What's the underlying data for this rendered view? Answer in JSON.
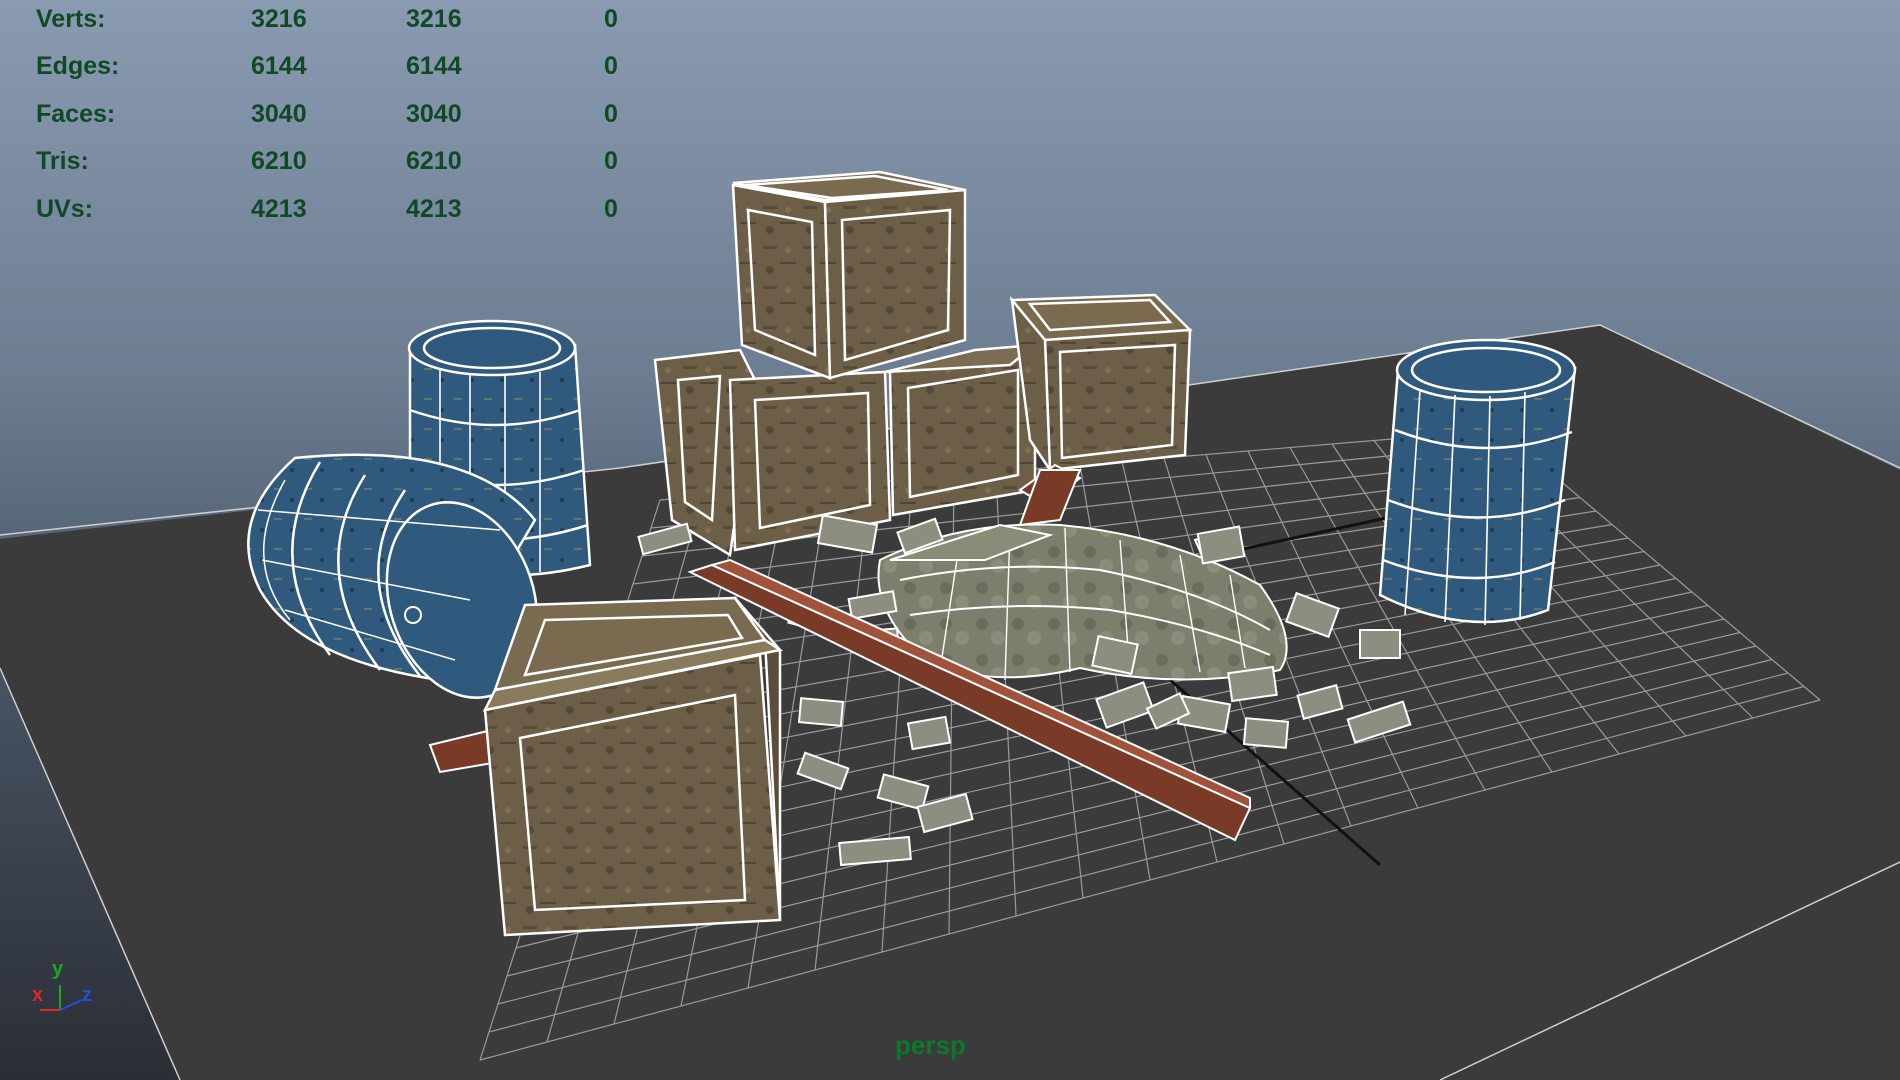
{
  "window": {
    "camera_label": "persp"
  },
  "hud": {
    "rows": [
      {
        "label": "Verts:",
        "c1": "3216",
        "c2": "3216",
        "c3": "0"
      },
      {
        "label": "Edges:",
        "c1": "6144",
        "c2": "6144",
        "c3": "0"
      },
      {
        "label": "Faces:",
        "c1": "3040",
        "c2": "3040",
        "c3": "0"
      },
      {
        "label": "Tris:",
        "c1": "6210",
        "c2": "6210",
        "c3": "0"
      },
      {
        "label": "UVs:",
        "c1": "4213",
        "c2": "4213",
        "c3": "0"
      }
    ]
  },
  "axis": {
    "x": "x",
    "y": "y",
    "z": "z"
  },
  "colors": {
    "hud_text": "#0f4a26",
    "camera_label": "#0a7a2a",
    "wireframe": "#ffffff",
    "barrel_blue": "#2f5a7d",
    "crate_wood": "#6e5f48",
    "plank_red": "#7a3a28",
    "ground": "#3a3a3a",
    "grid": "#9a9a9a"
  },
  "objects": [
    "barrel-upright-left",
    "barrel-fallen-left",
    "barrel-upright-right",
    "crate-top",
    "crate-bottom-left",
    "crate-bottom-middle",
    "crate-right",
    "crate-front",
    "rubble-pile",
    "wooden-beam",
    "ground-plane",
    "grid"
  ]
}
